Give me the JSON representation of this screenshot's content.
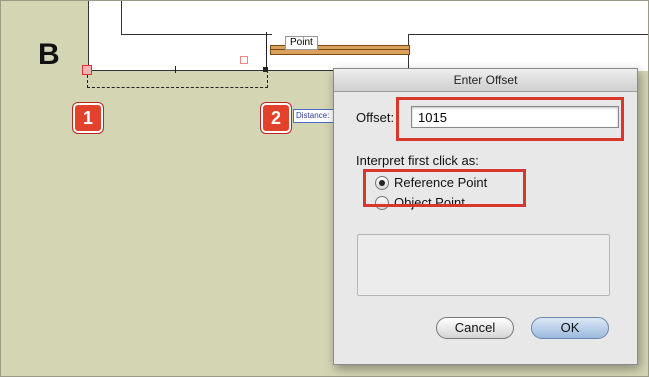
{
  "canvas": {
    "section_letter": "B",
    "point_label": "Point",
    "distance_label": "Distance:",
    "badges": [
      "1",
      "2"
    ]
  },
  "dialog": {
    "title": "Enter Offset",
    "offset_label": "Offset:",
    "offset_value": "1015",
    "interpret_label": "Interpret first click as:",
    "options": [
      {
        "label": "Reference Point",
        "selected": true
      },
      {
        "label": "Object Point",
        "selected": false
      }
    ],
    "cancel_label": "Cancel",
    "ok_label": "OK"
  },
  "colors": {
    "background": "#d3d5b3",
    "highlight": "#d8382a",
    "beam": "#d9a15c"
  }
}
